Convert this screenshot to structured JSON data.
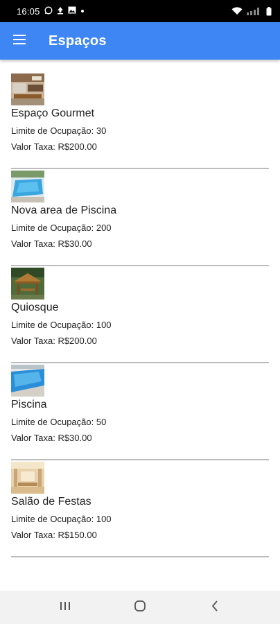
{
  "status_bar": {
    "time": "16:05",
    "icons_left": [
      "whatsapp-icon",
      "upload-icon",
      "image-icon",
      "dot-icon"
    ],
    "icons_right": [
      "wifi-icon",
      "signal-icon",
      "battery-icon"
    ]
  },
  "app_bar": {
    "title": "Espaços",
    "menu_icon": "hamburger-menu-icon",
    "background": "#3f86f5"
  },
  "spaces": [
    {
      "name": "Espaço Gourmet",
      "capacity": "Limite de Ocupação: 30",
      "fee": "Valor Taxa: R$200.00",
      "thumbnail": "gourmet-area-photo"
    },
    {
      "name": "Nova area de Piscina",
      "capacity": "Limite de Ocupação: 200",
      "fee": "Valor Taxa: R$30.00",
      "thumbnail": "pool-area-photo"
    },
    {
      "name": "Quiosque",
      "capacity": "Limite de Ocupação: 100",
      "fee": "Valor Taxa: R$200.00",
      "thumbnail": "kiosk-photo"
    },
    {
      "name": "Piscina",
      "capacity": "Limite de Ocupação: 50",
      "fee": "Valor Taxa: R$30.00",
      "thumbnail": "pool-photo"
    },
    {
      "name": "Salão de Festas",
      "capacity": "Limite de Ocupação: 100",
      "fee": "Valor Taxa: R$150.00",
      "thumbnail": "party-hall-photo"
    }
  ],
  "nav_bar": {
    "buttons": [
      "recent-apps-icon",
      "home-icon",
      "back-icon"
    ]
  }
}
